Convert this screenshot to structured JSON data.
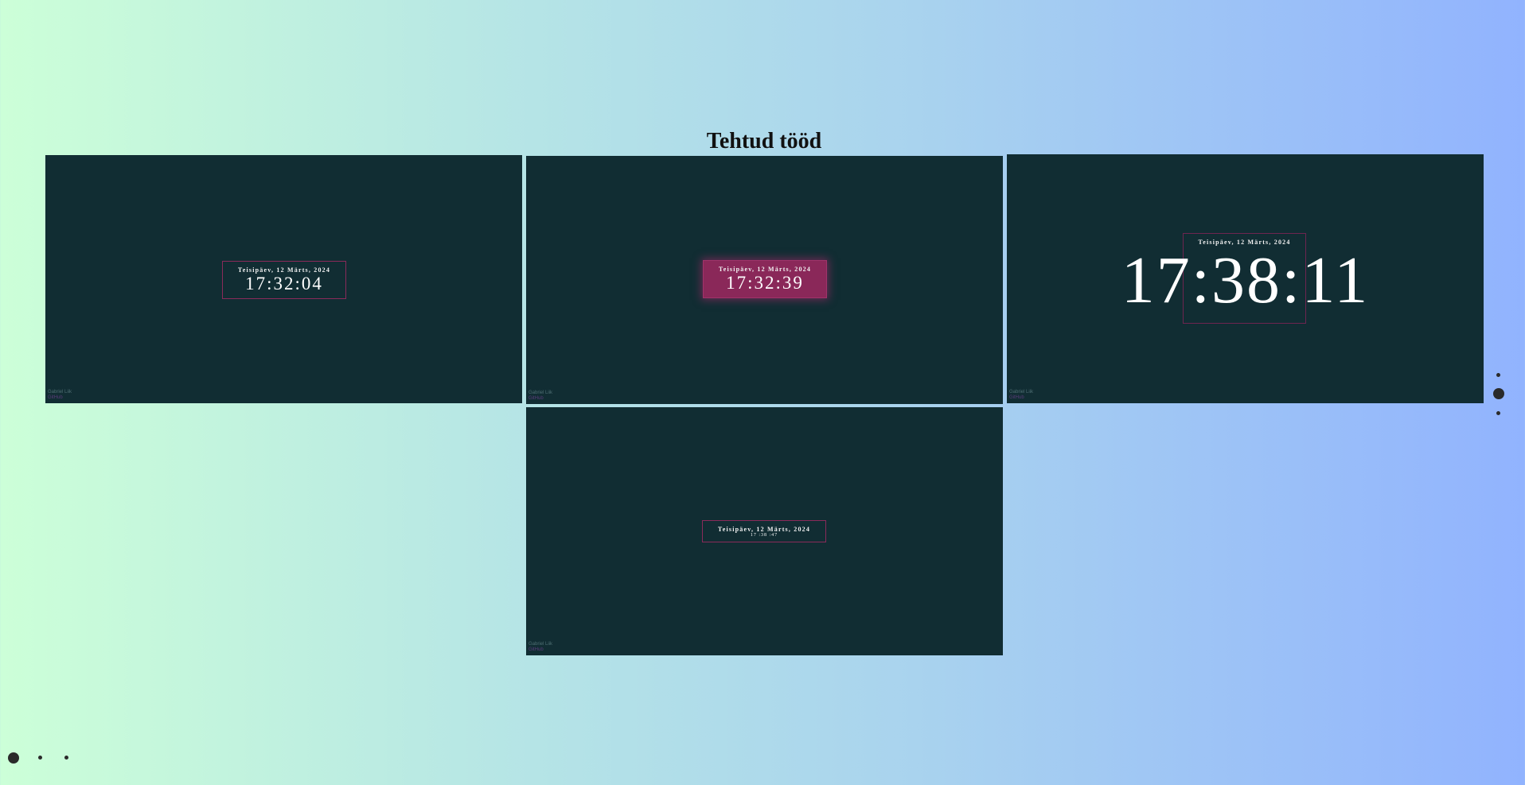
{
  "page": {
    "title": "Tehtud tööd"
  },
  "cards": [
    {
      "date": "Teisipäev, 12 Märts, 2024",
      "time": "17:32:04",
      "footer_text": "Gabriel Liik",
      "footer_link": "GitHub"
    },
    {
      "date": "Teisipäev, 12 Märts, 2024",
      "time": "17:32:39",
      "footer_text": "Gabriel Liik",
      "footer_link": "GitHub"
    },
    {
      "date": "Teisipäev, 12 Märts, 2024",
      "time": "17:38:11",
      "footer_text": "Gabriel Liik",
      "footer_link": "GitHub"
    },
    {
      "date": "Teisipäev, 12 Märts, 2024",
      "time": "17 :38 :47",
      "footer_text": "Gabriel Liik",
      "footer_link": "GitHub"
    }
  ],
  "colors": {
    "card_background": "#112d33",
    "accent": "#8a2859",
    "gradient_start": "#ccffd8",
    "gradient_end": "#91b3fe"
  }
}
